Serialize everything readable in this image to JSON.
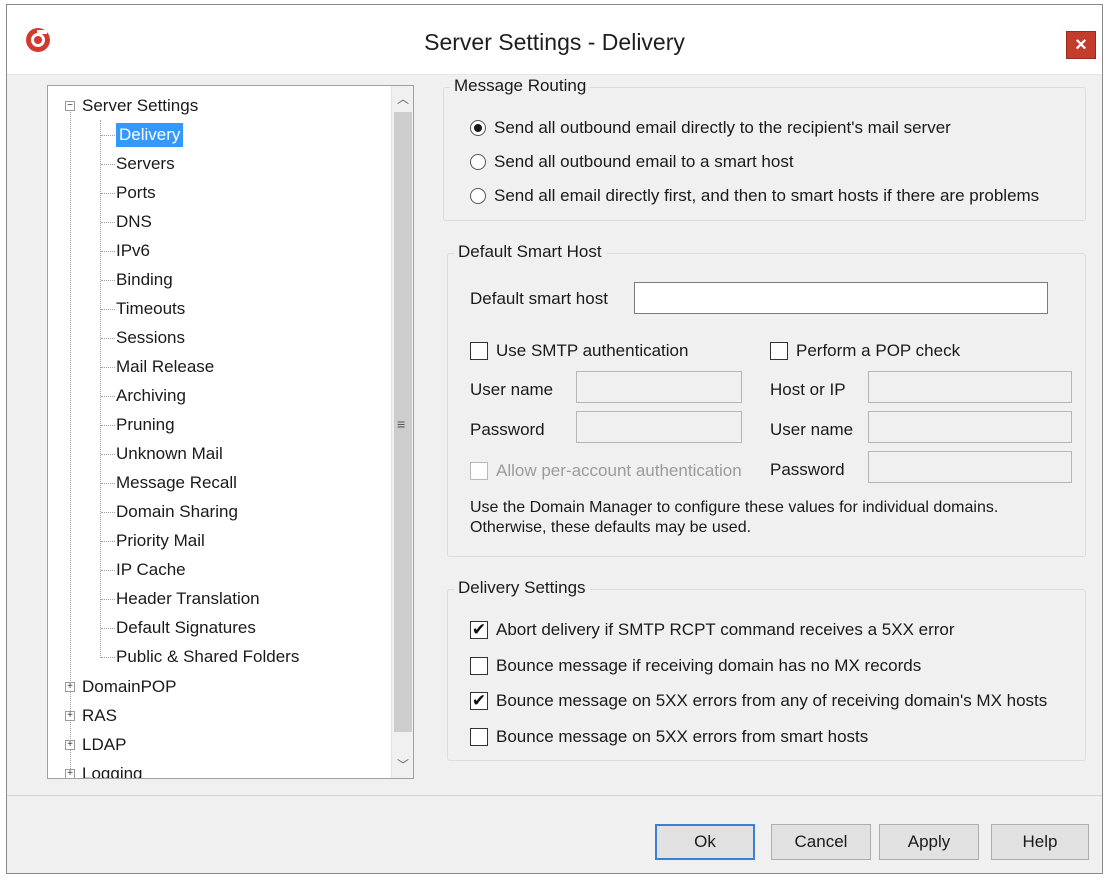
{
  "window": {
    "title": "Server Settings - Delivery",
    "close_glyph": "×"
  },
  "tree": {
    "root": "Server Settings",
    "children": [
      "Delivery",
      "Servers",
      "Ports",
      "DNS",
      "IPv6",
      "Binding",
      "Timeouts",
      "Sessions",
      "Mail Release",
      "Archiving",
      "Pruning",
      "Unknown Mail",
      "Message Recall",
      "Domain Sharing",
      "Priority Mail",
      "IP Cache",
      "Header Translation",
      "Default Signatures",
      "Public & Shared Folders"
    ],
    "selected": "Delivery",
    "others": [
      "DomainPOP",
      "RAS",
      "LDAP",
      "Logging"
    ]
  },
  "routing": {
    "title": "Message Routing",
    "options": [
      "Send all outbound email directly to the recipient's mail server",
      "Send all outbound email to a smart host",
      "Send all email directly first, and then to smart hosts if there are problems"
    ],
    "selected_index": 0
  },
  "smart_host": {
    "title": "Default Smart Host",
    "host_label": "Default smart host",
    "host_value": "",
    "smtp_auth_label": "Use SMTP authentication",
    "smtp_auth_checked": false,
    "pop_check_label": "Perform a POP check",
    "pop_check_checked": false,
    "user_name_label": "User name",
    "password_label": "Password",
    "host_ip_label": "Host or IP",
    "pop_user_label": "User name",
    "pop_password_label": "Password",
    "per_account_label": "Allow per-account authentication",
    "note_line1": "Use the Domain Manager to configure these values for individual domains.",
    "note_line2": "Otherwise, these defaults may be used."
  },
  "delivery": {
    "title": "Delivery Settings",
    "options": [
      {
        "label": "Abort delivery if SMTP RCPT command receives a  5XX error",
        "checked": true
      },
      {
        "label": "Bounce message if receiving domain has no MX records",
        "checked": false
      },
      {
        "label": "Bounce message on 5XX errors from any of receiving domain's MX hosts",
        "checked": true
      },
      {
        "label": "Bounce message on 5XX errors from smart hosts",
        "checked": false
      }
    ]
  },
  "buttons": {
    "ok": "Ok",
    "cancel": "Cancel",
    "apply": "Apply",
    "help": "Help"
  },
  "colors": {
    "selection": "#3399ff",
    "close": "#c43c2b",
    "default_button_border": "#3c7fd4"
  }
}
